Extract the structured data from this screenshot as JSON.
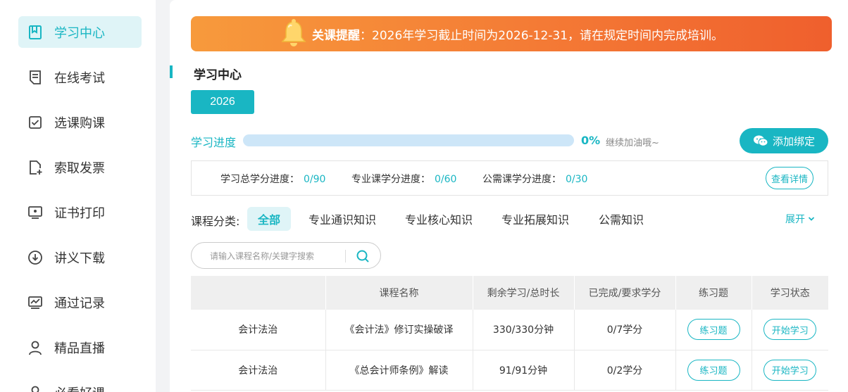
{
  "sidebar": {
    "items": [
      {
        "label": "学习中心",
        "icon": "bookmark-icon",
        "active": true
      },
      {
        "label": "在线考试",
        "icon": "document-icon",
        "active": false
      },
      {
        "label": "选课购课",
        "icon": "checkbox-icon",
        "active": false
      },
      {
        "label": "索取发票",
        "icon": "file-add-icon",
        "active": false
      },
      {
        "label": "证书打印",
        "icon": "monitor-icon",
        "active": false
      },
      {
        "label": "讲义下载",
        "icon": "download-icon",
        "active": false
      },
      {
        "label": "通过记录",
        "icon": "chart-icon",
        "active": false
      },
      {
        "label": "精品直播",
        "icon": "user-icon",
        "active": false
      },
      {
        "label": "必看好课",
        "icon": "user-icon",
        "active": false
      }
    ]
  },
  "banner": {
    "title": "关课提醒",
    "message": "：2026年学习截止时间为2026-12-31，请在规定时间内完成培训。"
  },
  "section": {
    "title": "学习中心"
  },
  "year": {
    "label": "2026"
  },
  "progress": {
    "label": "学习进度",
    "value": 0,
    "percent_text": "0%",
    "tip": "继续加油哦~"
  },
  "bind_button": {
    "label": "添加绑定"
  },
  "credits": {
    "total_label": "学习总学分进度：",
    "total_value": "0/90",
    "major_label": "专业课学分进度：",
    "major_value": "0/60",
    "public_label": "公需课学分进度：",
    "public_value": "0/30",
    "detail_label": "查看详情"
  },
  "categories": {
    "label": "课程分类:",
    "tabs": [
      "全部",
      "专业通识知识",
      "专业核心知识",
      "专业拓展知识",
      "公需知识"
    ],
    "active_index": 0,
    "expand_label": "展开"
  },
  "search": {
    "placeholder": "请输入课程名称/关键字搜索",
    "value": ""
  },
  "table": {
    "headers": [
      "",
      "课程名称",
      "剩余学习/总时长",
      "已完成/要求学分",
      "练习题",
      "学习状态"
    ],
    "rows": [
      {
        "category": "会计法治",
        "name": "《会计法》修订实操破译",
        "duration": "330/330分钟",
        "credits": "0/7学分",
        "exercise": "练习题",
        "status": "开始学习"
      },
      {
        "category": "会计法治",
        "name": "《总会计师条例》解读",
        "duration": "91/91分钟",
        "credits": "0/2学分",
        "exercise": "练习题",
        "status": "开始学习"
      }
    ]
  },
  "colors": {
    "accent": "#19b6c3",
    "banner_start": "#f79a3c",
    "banner_end": "#ef5f2d"
  }
}
